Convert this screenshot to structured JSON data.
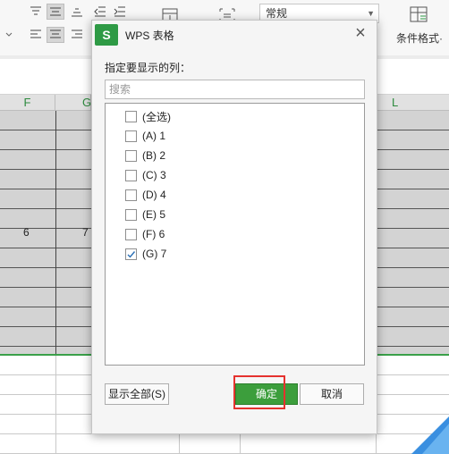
{
  "ribbon": {
    "number_format": "常规",
    "conditional_format_label": "条件格式·"
  },
  "sheet": {
    "columns": [
      "F",
      "G",
      "L"
    ],
    "row1": {
      "f": "6",
      "g": "7"
    }
  },
  "dialog": {
    "logo_letter": "S",
    "title": "WPS 表格",
    "close": "×",
    "prompt": "指定要显示的列：",
    "search_placeholder": "搜索",
    "items": [
      {
        "label": "(全选)",
        "checked": false
      },
      {
        "label": "(A) 1",
        "checked": false
      },
      {
        "label": "(B) 2",
        "checked": false
      },
      {
        "label": "(C) 3",
        "checked": false
      },
      {
        "label": "(D) 4",
        "checked": false
      },
      {
        "label": "(E) 5",
        "checked": false
      },
      {
        "label": "(F) 6",
        "checked": false
      },
      {
        "label": "(G) 7",
        "checked": true
      }
    ],
    "show_all_button": "显示全部(S)",
    "ok_button": "确定",
    "cancel_button": "取消"
  },
  "colors": {
    "accent_green": "#3c9e3c",
    "highlight_red": "#e5322e",
    "column_header_text": "#2d8a3e"
  }
}
